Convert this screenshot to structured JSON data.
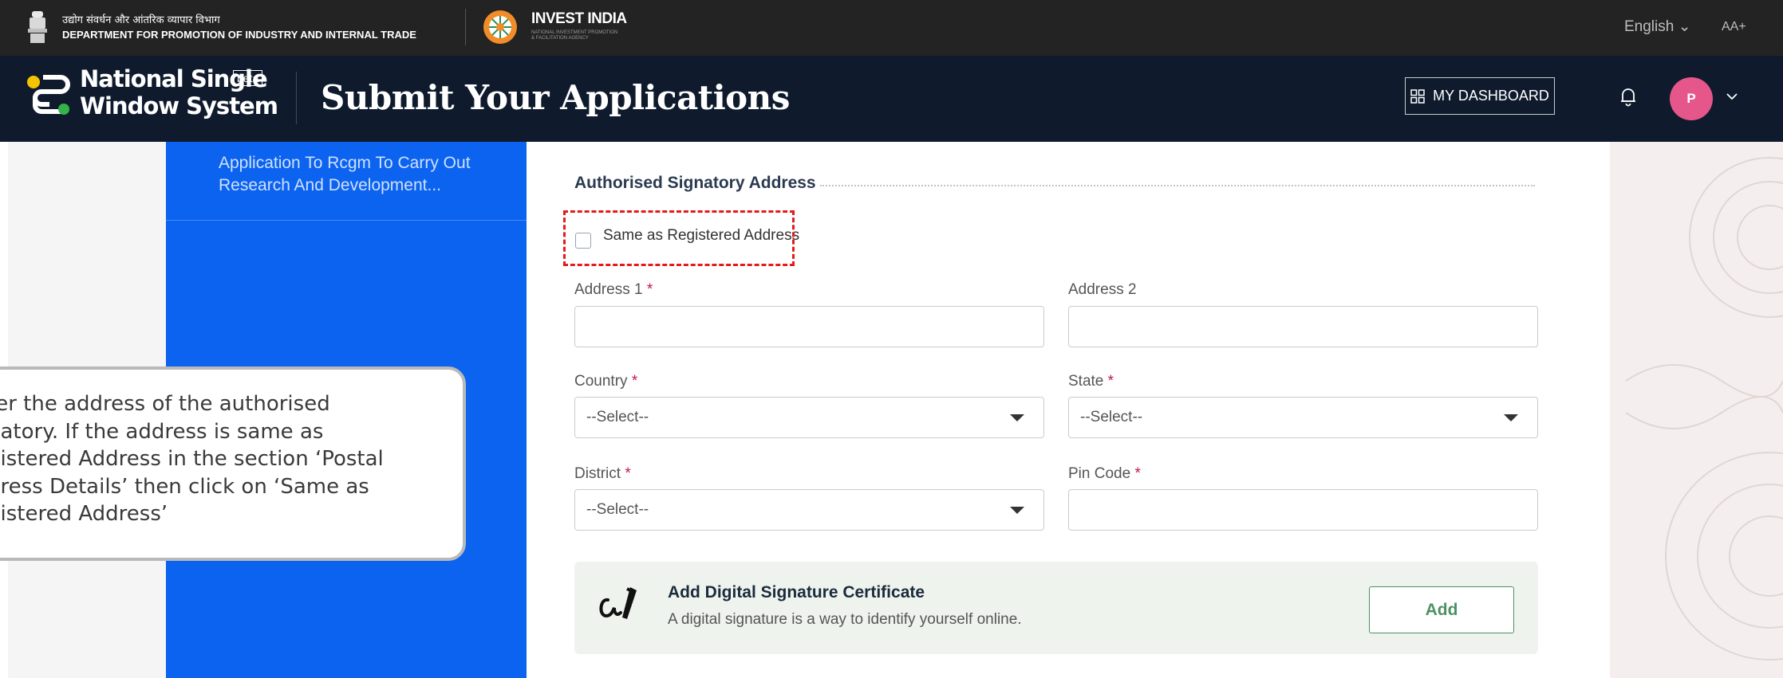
{
  "gov_strip": {
    "dept_hindi": "उद्योग संवर्धन और आंतरिक व्यापार विभाग",
    "dept_english": "DEPARTMENT FOR PROMOTION OF INDUSTRY AND INTERNAL TRADE",
    "invest_india": "INVEST INDIA",
    "invest_india_sub": "NATIONAL INVESTMENT PROMOTION & FACILITATION AGENCY",
    "language": "English",
    "font_size": "AA+"
  },
  "header": {
    "brand_line1": "National Single",
    "brand_line2": "Window System",
    "beta": "beta",
    "title": "Submit Your Applications",
    "dashboard_label": "MY DASHBOARD",
    "avatar_initial": "P"
  },
  "sidebar": {
    "items": [
      {
        "label": "Application To Rcgm To Carry Out Research And Development..."
      }
    ]
  },
  "form": {
    "section_title": "Authorised Signatory Address",
    "same_as_label": "Same as Registered Address",
    "address1_label": "Address 1",
    "address2_label": "Address 2",
    "country_label": "Country",
    "state_label": "State",
    "district_label": "District",
    "pincode_label": "Pin Code",
    "required_mark": "*",
    "select_placeholder": "--Select--",
    "country_value": "--Select--",
    "state_value": "--Select--",
    "district_value": "--Select--"
  },
  "dsc": {
    "title": "Add Digital Signature Certificate",
    "subtitle": "A digital signature is a way to identify yourself online.",
    "add_label": "Add"
  },
  "callout": {
    "text": "ter the address of the authorised\nnatory. If the address is same as\ngistered Address in the section ‘Postal\ndress Details’ then click on ‘Same as\ngistered Address’"
  },
  "colors": {
    "strip_bg": "#232323",
    "header_bg": "#0f1b2d",
    "sidebar_bg": "#0b63f0",
    "avatar": "#e5578a",
    "accent_green": "#4d9063",
    "required": "#c0174d",
    "highlight": "#e21b1b"
  }
}
